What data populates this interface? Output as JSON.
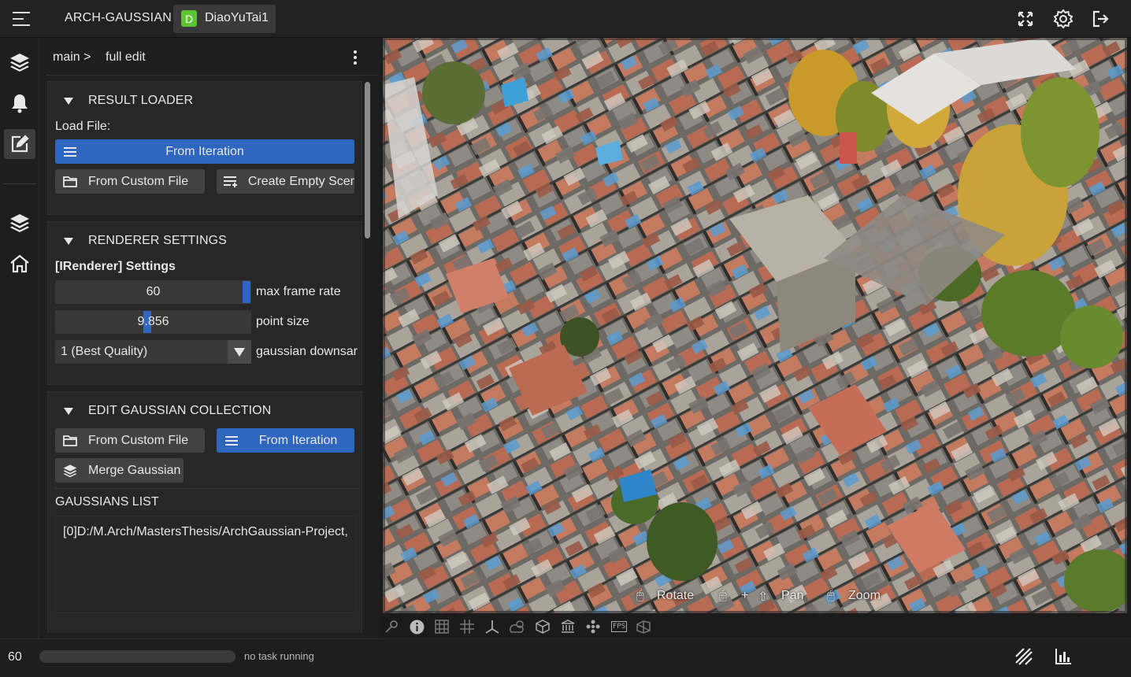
{
  "header": {
    "app_title": "ARCH-GAUSSIAN",
    "scene_badge": "D",
    "scene_name": "DiaoYuTai1",
    "icons": [
      "fullscreen-icon",
      "settings-icon",
      "logout-icon"
    ]
  },
  "rail": {
    "items": [
      "layers-icon",
      "bell-icon",
      "edit-icon",
      "stack-icon",
      "home-icon"
    ],
    "active": "edit-icon"
  },
  "breadcrumb": {
    "root": "main >",
    "current": "full edit"
  },
  "result_loader": {
    "title": "RESULT LOADER",
    "load_file_label": "Load File:",
    "from_iteration": "From Iteration",
    "from_custom_file": "From Custom File",
    "create_empty_scene": "Create Empty Scer"
  },
  "renderer_settings": {
    "title": "RENDERER SETTINGS",
    "subtitle": "[IRenderer] Settings",
    "max_frame_rate_value": "60",
    "max_frame_rate_label": "max frame rate",
    "point_size_value": "9.856",
    "point_size_label": "point size",
    "downsample_value": "1 (Best Quality)",
    "downsample_label": "gaussian downsar"
  },
  "edit_collection": {
    "title": "EDIT GAUSSIAN COLLECTION",
    "from_custom_file": "From Custom File",
    "from_iteration": "From Iteration",
    "merge_gaussian": "Merge Gaussian",
    "list_title": "GAUSSIANS LIST",
    "list_items": [
      "[0]D:/M.Arch/MastersThesis/ArchGaussian-Project,"
    ]
  },
  "viewport": {
    "hint_rotate": "Rotate",
    "hint_plus": "+",
    "hint_pan": "Pan",
    "hint_zoom": "Zoom",
    "tools": [
      "wrench-icon",
      "info-icon",
      "grid-box-icon",
      "grid-icon",
      "axes-icon",
      "weather-icon",
      "cube-icon",
      "temple-icon",
      "cluster-icon",
      "fps-icon",
      "camera-frustum-icon"
    ],
    "fps_tool_text": "FPS"
  },
  "status": {
    "fps": "60",
    "task": "no task running",
    "progress": 0
  },
  "colors": {
    "accent_blue": "#2f66c0",
    "badge_green": "#5fc435"
  }
}
